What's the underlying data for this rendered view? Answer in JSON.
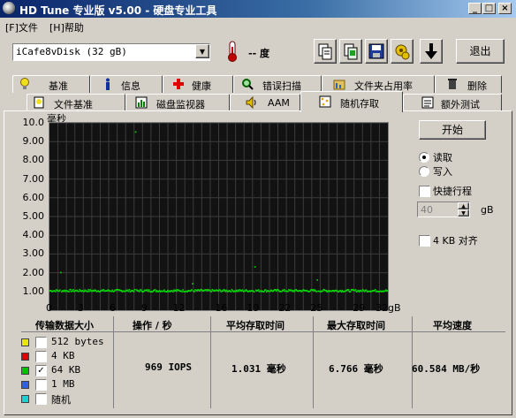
{
  "window": {
    "title": "HD Tune 专业版 v5.00 - 硬盘专业工具",
    "min": "_",
    "max": "□",
    "close": "×"
  },
  "menu": {
    "file": "[F]文件",
    "help": "[H]帮助"
  },
  "toolbar": {
    "drive_selected": "iCafe8vDisk (32 gB)",
    "temperature": "-- 度",
    "exit_label": "退出",
    "icons": [
      "copy-info-icon",
      "copy-screen-icon",
      "save-icon",
      "options-icon",
      "down-arrow-icon"
    ]
  },
  "tabs_row1": [
    {
      "label": "基准",
      "icon": "lightbulb-icon"
    },
    {
      "label": "信息",
      "icon": "info-icon"
    },
    {
      "label": "健康",
      "icon": "health-cross-icon"
    },
    {
      "label": "错误扫描",
      "icon": "magnifier-icon"
    },
    {
      "label": "文件夹占用率",
      "icon": "folder-usage-icon"
    },
    {
      "label": "删除",
      "icon": "trash-icon"
    }
  ],
  "tabs_row2": [
    {
      "label": "文件基准",
      "icon": "file-benchmark-icon"
    },
    {
      "label": "磁盘监视器",
      "icon": "monitor-chart-icon"
    },
    {
      "label": "AAM",
      "icon": "speaker-icon"
    },
    {
      "label": "随机存取",
      "icon": "random-access-icon",
      "active": true
    },
    {
      "label": "额外测试",
      "icon": "extra-tests-icon"
    }
  ],
  "chart": {
    "ylabel": "毫秒",
    "colors": {
      "bg": "#121212",
      "grid": "#3c3c3c",
      "trace": "#00e000"
    }
  },
  "chart_data": {
    "type": "scatter",
    "ylabel": "毫秒",
    "xlabel": "gB",
    "yticks": [
      "10.0",
      "9.00",
      "8.00",
      "7.00",
      "6.00",
      "5.00",
      "4.00",
      "3.00",
      "2.00",
      "1.00"
    ],
    "xticks": [
      "0",
      "3",
      "6",
      "9",
      "12",
      "16",
      "19",
      "22",
      "25",
      "29",
      "32gB"
    ],
    "xlim": [
      0,
      32
    ],
    "ylim": [
      0,
      10
    ],
    "grid": true,
    "series": [
      {
        "name": "64 KB",
        "color": "#00e000",
        "typical_y": 1.03,
        "max_y": 6.766
      }
    ]
  },
  "controls": {
    "start_label": "开始",
    "read_label": "读取",
    "write_label": "写入",
    "quick_label": "快捷行程",
    "quick_value": "40",
    "quick_unit": "gB",
    "align_label": "4 KB 对齐"
  },
  "results": {
    "headers": [
      "传输数据大小",
      "操作 / 秒",
      "平均存取时间",
      "最大存取时间",
      "平均速度"
    ],
    "rows": [
      {
        "size": "512 bytes",
        "color": "#e8e800",
        "checked": false,
        "ops": "",
        "avg": "",
        "max": "",
        "speed": ""
      },
      {
        "size": "4 KB",
        "color": "#e00000",
        "checked": false,
        "ops": "",
        "avg": "",
        "max": "",
        "speed": ""
      },
      {
        "size": "64 KB",
        "color": "#00c000",
        "checked": true,
        "ops": "969 IOPS",
        "avg": "1.031 毫秒",
        "max": "6.766 毫秒",
        "speed": "60.584 MB/秒"
      },
      {
        "size": "1 MB",
        "color": "#3060e0",
        "checked": false,
        "ops": "",
        "avg": "",
        "max": "",
        "speed": ""
      },
      {
        "size": "随机",
        "color": "#20d0d0",
        "checked": false,
        "ops": "",
        "avg": "",
        "max": "",
        "speed": ""
      }
    ]
  }
}
